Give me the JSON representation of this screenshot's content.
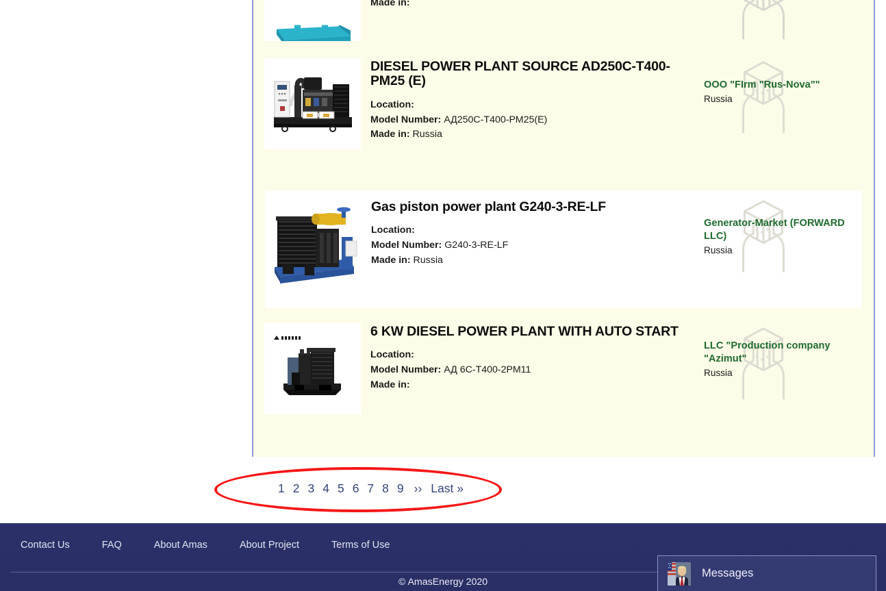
{
  "results": {
    "items": [
      {
        "id": "card-partial-top",
        "title": "",
        "specs": [
          {
            "label": "Made in:",
            "value": ""
          }
        ],
        "supplier_name": "",
        "supplier_country": "",
        "thumb": "cyan-skid-frame-image",
        "background": "cream",
        "partial": true
      },
      {
        "id": "card-ad250c",
        "title": "DIESEL POWER PLANT SOURCE AD250C-T400-PM25 (E)",
        "specs": [
          {
            "label": "Location:",
            "value": ""
          },
          {
            "label": "Model Number:",
            "value": "АД250С-Т400-РМ25(Е)"
          },
          {
            "label": "Made in:",
            "value": "Russia"
          }
        ],
        "supplier_name": "OOO \"FIrm \"Rus-Nova\"\"",
        "supplier_country": "Russia",
        "thumb": "open-frame-diesel-generator-image",
        "background": "cream"
      },
      {
        "id": "card-g240",
        "title": "Gas piston power plant G240-3-RE-LF",
        "specs": [
          {
            "label": "Location:",
            "value": ""
          },
          {
            "label": "Model Number:",
            "value": "G240-3-RE-LF"
          },
          {
            "label": "Made in:",
            "value": "Russia"
          }
        ],
        "supplier_name": "Generator-Market (FORWARD LLC)",
        "supplier_country": "Russia",
        "thumb": "blue-gas-piston-plant-image",
        "background": "white"
      },
      {
        "id": "card-6kw",
        "title": "6 KW DIESEL POWER PLANT WITH AUTO START",
        "specs": [
          {
            "label": "Location:",
            "value": ""
          },
          {
            "label": "Model Number:",
            "value": "АД 6С-Т400-2РМ11"
          },
          {
            "label": "Made in:",
            "value": ""
          }
        ],
        "supplier_name": "LLC \"Production company \"Azimut\"",
        "supplier_country": "Russia",
        "thumb": "black-diesel-generator-image",
        "background": "cream"
      }
    ]
  },
  "pagination": {
    "pages": [
      "1",
      "2",
      "3",
      "4",
      "5",
      "6",
      "7",
      "8",
      "9"
    ],
    "next_label": "››",
    "last_label": "Last »",
    "annotation": "red-ellipse-highlight"
  },
  "footer": {
    "links": [
      {
        "label": "Contact Us"
      },
      {
        "label": "FAQ"
      },
      {
        "label": "About Amas"
      },
      {
        "label": "About Project"
      },
      {
        "label": "Terms of Use"
      }
    ],
    "copyright": "© AmasEnergy 2020"
  },
  "messages_widget": {
    "label": "Messages",
    "avatar": "user-portrait-avatar"
  },
  "colors": {
    "card_cream": "#fdfce8",
    "card_white": "#ffffff",
    "supplier_green": "#1f6b2e",
    "pager_blue": "#33447a",
    "footer_navy": "#2a3066",
    "annotation_red": "#f51717",
    "panel_border": "#8f97d6"
  }
}
